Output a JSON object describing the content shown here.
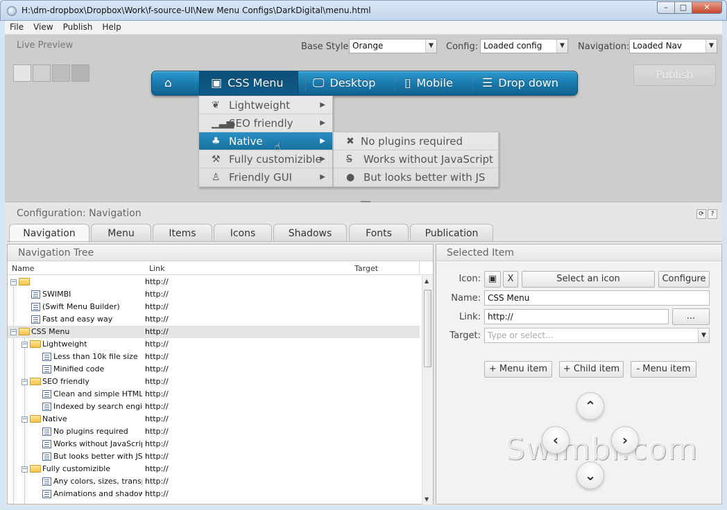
{
  "window": {
    "title": "H:\\dm-dropbox\\Dropbox\\Work\\f-source-UI\\New Menu Configs\\DarkDigital\\menu.html",
    "min": "–",
    "max": "□",
    "close": "✕"
  },
  "menubar": [
    "File",
    "View",
    "Publish",
    "Help"
  ],
  "preview": {
    "title": "Live Preview",
    "base_style_label": "Base Style:",
    "base_style_value": "Orange",
    "config_label": "Config:",
    "config_value": "Loaded config",
    "navigation_label": "Navigation:",
    "navigation_value": "Loaded Nav",
    "publish_label": "Publish"
  },
  "demo_menu": {
    "items": [
      {
        "icon": "home-icon",
        "label": ""
      },
      {
        "icon": "css3-icon",
        "label": "CSS Menu"
      },
      {
        "icon": "desktop-icon",
        "label": "Desktop"
      },
      {
        "icon": "mobile-icon",
        "label": "Mobile"
      },
      {
        "icon": "list-icon",
        "label": "Drop down"
      }
    ],
    "dropdown": [
      "Lightweight",
      "SEO friendly",
      "Native",
      "Fully customizible",
      "Friendly GUI"
    ],
    "submenu": [
      "No plugins required",
      "Works without JavaScript",
      "But looks better with JS"
    ]
  },
  "config": {
    "title": "Configuration: Navigation",
    "tabs": [
      "Navigation",
      "Menu",
      "Items",
      "Icons",
      "Shadows",
      "Fonts",
      "Publication"
    ]
  },
  "tree": {
    "title": "Navigation Tree",
    "columns": {
      "name": "Name",
      "link": "Link",
      "target": "Target"
    },
    "rows": [
      {
        "name": "",
        "link": "http://"
      },
      {
        "name": "SWIMBI",
        "link": "http://"
      },
      {
        "name": "(Swift Menu Builder)",
        "link": "http://"
      },
      {
        "name": "Fast and easy way",
        "link": "http://"
      },
      {
        "name": "CSS Menu",
        "link": "http://"
      },
      {
        "name": "Lightweight",
        "link": "http://"
      },
      {
        "name": "Less than 10k file size",
        "link": "http://"
      },
      {
        "name": "Minified code",
        "link": "http://"
      },
      {
        "name": "SEO friendly",
        "link": "http://"
      },
      {
        "name": "Clean and simple HTML li...",
        "link": "http://"
      },
      {
        "name": "Indexed by search engines",
        "link": "http://"
      },
      {
        "name": "Native",
        "link": "http://"
      },
      {
        "name": "No plugins required",
        "link": "http://"
      },
      {
        "name": "Works without JavaScript",
        "link": "http://"
      },
      {
        "name": "But looks better with JS",
        "link": "http://"
      },
      {
        "name": "Fully customizible",
        "link": "http://"
      },
      {
        "name": "Any colors, sizes, transp...",
        "link": "http://"
      },
      {
        "name": "Animations and shadows",
        "link": "http://"
      }
    ]
  },
  "selected": {
    "title": "Selected Item",
    "icon_label": "Icon:",
    "clear_label": "X",
    "select_icon_label": "Select an icon",
    "configure_label": "Configure",
    "name_label": "Name:",
    "name_value": "CSS Menu",
    "link_label": "Link:",
    "link_value": "http://",
    "browse_label": "...",
    "target_label": "Target:",
    "target_placeholder": "Type or select...",
    "add_item": "+ Menu item",
    "add_child": "+ Child item",
    "remove_item": "- Menu item",
    "watermark": "Swimbi.com"
  }
}
